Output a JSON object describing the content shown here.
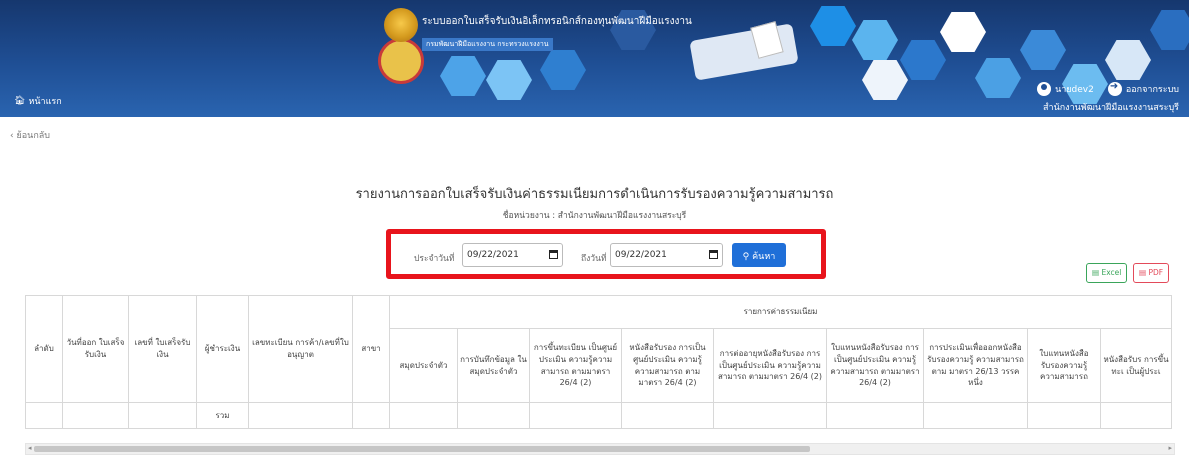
{
  "header": {
    "system_title": "ระบบออกใบเสร็จรับเงินอิเล็กทรอนิกส์กองทุนพัฒนาฝีมือแรงงาน",
    "department": "กรมพัฒนาฝีมือแรงงาน กระทรวงแรงงาน",
    "home_label": "หน้าแรก",
    "username": "นายdev2",
    "logout_label": "ออกจากระบบ",
    "office": "สำนักงานพัฒนาฝีมือแรงงานสระบุรี"
  },
  "nav": {
    "back_label": "ย้อนกลับ"
  },
  "report": {
    "title": "รายงานการออกใบเสร็จรับเงินค่าธรรมเนียมการดำเนินการรับรองความรู้ความสามารถ",
    "agency_line": "ชื่อหน่วยงาน : สำนักงานพัฒนาฝีมือแรงงานสระบุรี"
  },
  "filter": {
    "date_from_label": "ประจำวันที่",
    "date_from_value": "09/22/2021",
    "date_to_label": "ถึงวันที่",
    "date_to_value": "09/22/2021",
    "search_label": "ค้นหา"
  },
  "export": {
    "excel_label": "Excel",
    "pdf_label": "PDF"
  },
  "table": {
    "fee_group_header": "รายการค่าธรรมเนียม",
    "columns": [
      "ลำดับ",
      "วันที่ออก ใบเสร็จรับเงิน",
      "เลขที่ ใบเสร็จรับเงิน",
      "ผู้ชำระเงิน",
      "เลขทะเบียน การค้า/เลขที่ใบอนุญาต",
      "สาขา"
    ],
    "fee_columns": [
      "สมุดประจำตัว",
      "การบันทึกข้อมูล ในสมุดประจำตัว",
      "การขึ้นทะเบียน เป็นศูนย์ประเมิน ความรู้ความสามารถ ตามมาตรา 26/4 (2)",
      "หนังสือรับรอง การเป็นศูนย์ประเมิน ความรู้ความสามารถ ตามมาตรา 26/4 (2)",
      "การต่ออายุหนังสือรับรอง การเป็นศูนย์ประเมิน ความรู้ความสามารถ ตามมาตรา 26/4 (2)",
      "ใบแทนหนังสือรับรอง การเป็นศูนย์ประเมิน ความรู้ความสามารถ ตามมาตรา 26/4 (2)",
      "การประเมินเพื่อออกหนังสือ รับรองความรู้ ความสามารถตาม มาตรา 26/13 วรรคหนึ่ง",
      "ใบแทนหนังสือ รับรองความรู้ ความสามารถ",
      "หนังสือรับร การขึ้นทะเ เป็นผู้ประเ"
    ],
    "total_label": "รวม"
  }
}
